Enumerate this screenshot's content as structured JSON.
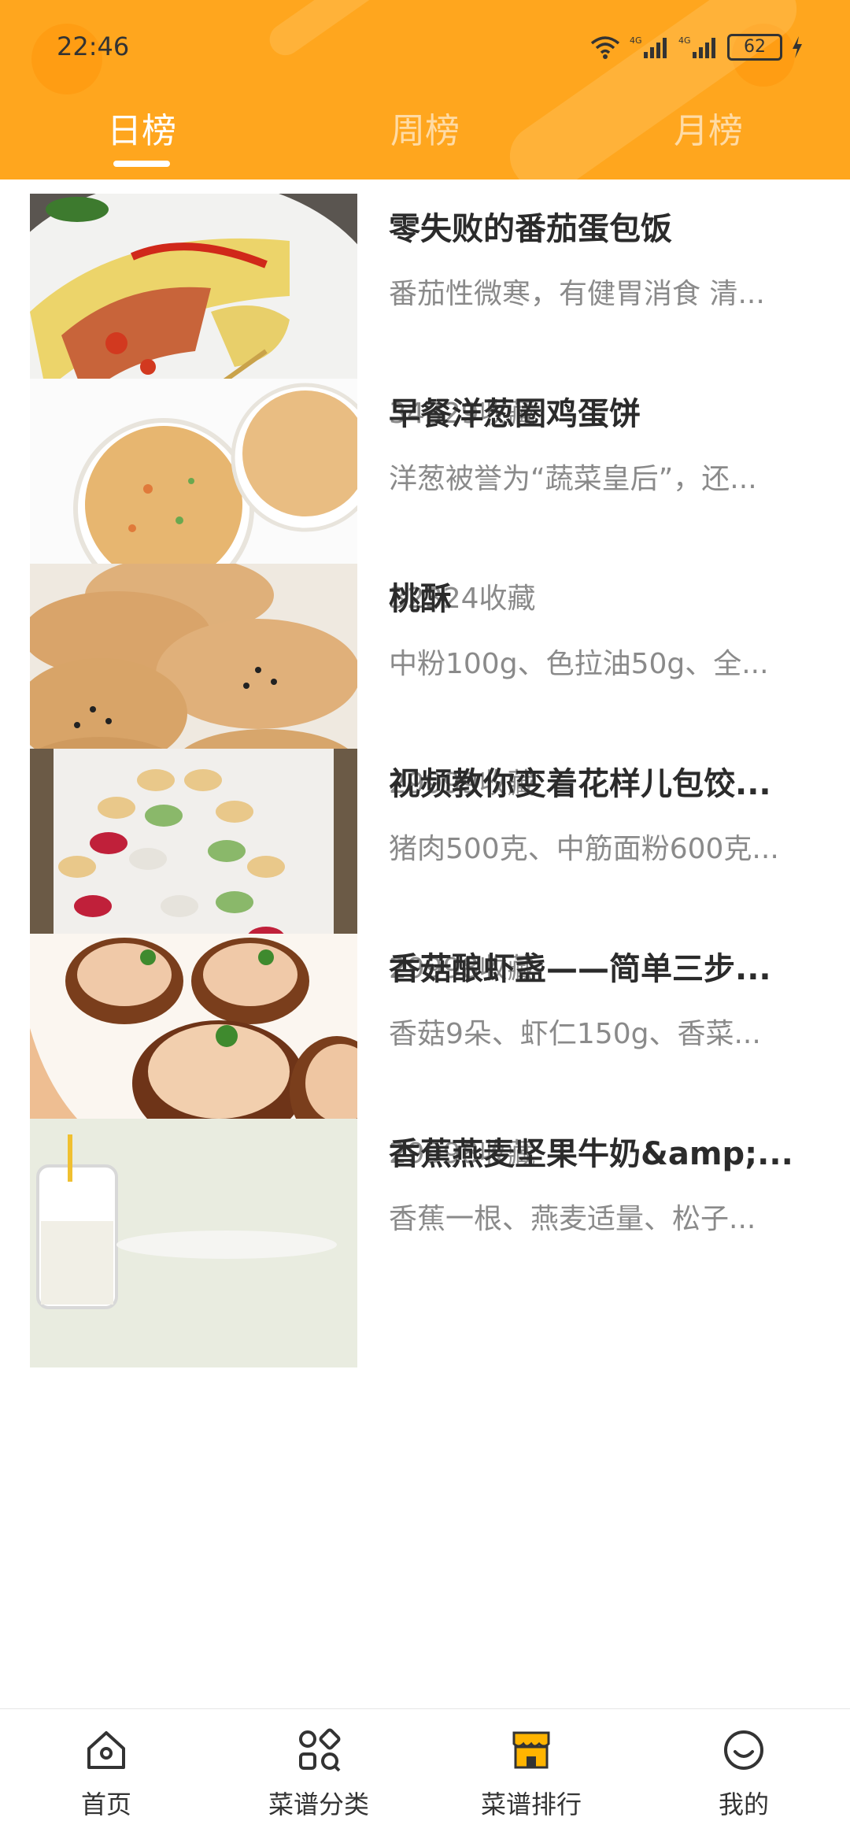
{
  "status": {
    "time": "22:46",
    "network1": "4G",
    "network2": "4G",
    "battery": "62"
  },
  "tabs": [
    {
      "label": "日榜"
    },
    {
      "label": "周榜"
    },
    {
      "label": "月榜"
    }
  ],
  "recipes": [
    {
      "title": "零失败的番茄蛋包饭",
      "desc": "番茄性微寒，有健胃消食 清...",
      "favorites": "34329收藏"
    },
    {
      "title": "早餐洋葱圈鸡蛋饼",
      "desc": "洋葱被誉为“蔬菜皇后”，还...",
      "favorites": "32324收藏"
    },
    {
      "title": "桃酥",
      "desc": "中粉100g、色拉油50g、全...",
      "favorites": "29999收藏"
    },
    {
      "title": "视频教你变着花样儿包饺...",
      "desc": "猪肉500克、中筋面粉600克...",
      "favorites": "29998收藏"
    },
    {
      "title": "香菇酿虾盏——简单三步...",
      "desc": "香菇9朵、虾仁150g、香菜...",
      "favorites": "29998收藏"
    },
    {
      "title": "香蕉燕麦坚果牛奶&amp;...",
      "desc": "香蕉一根、燕麦适量、松子...",
      "favorites": ""
    }
  ],
  "bottom_nav": [
    {
      "label": "首页",
      "icon": "home-icon"
    },
    {
      "label": "菜谱分类",
      "icon": "category-icon"
    },
    {
      "label": "菜谱排行",
      "icon": "ranking-icon"
    },
    {
      "label": "我的",
      "icon": "profile-icon"
    }
  ],
  "colors": {
    "accent": "#FFA61E",
    "active_nav": "#FFA61E",
    "text": "#333333",
    "muted": "#8a8a8a"
  }
}
